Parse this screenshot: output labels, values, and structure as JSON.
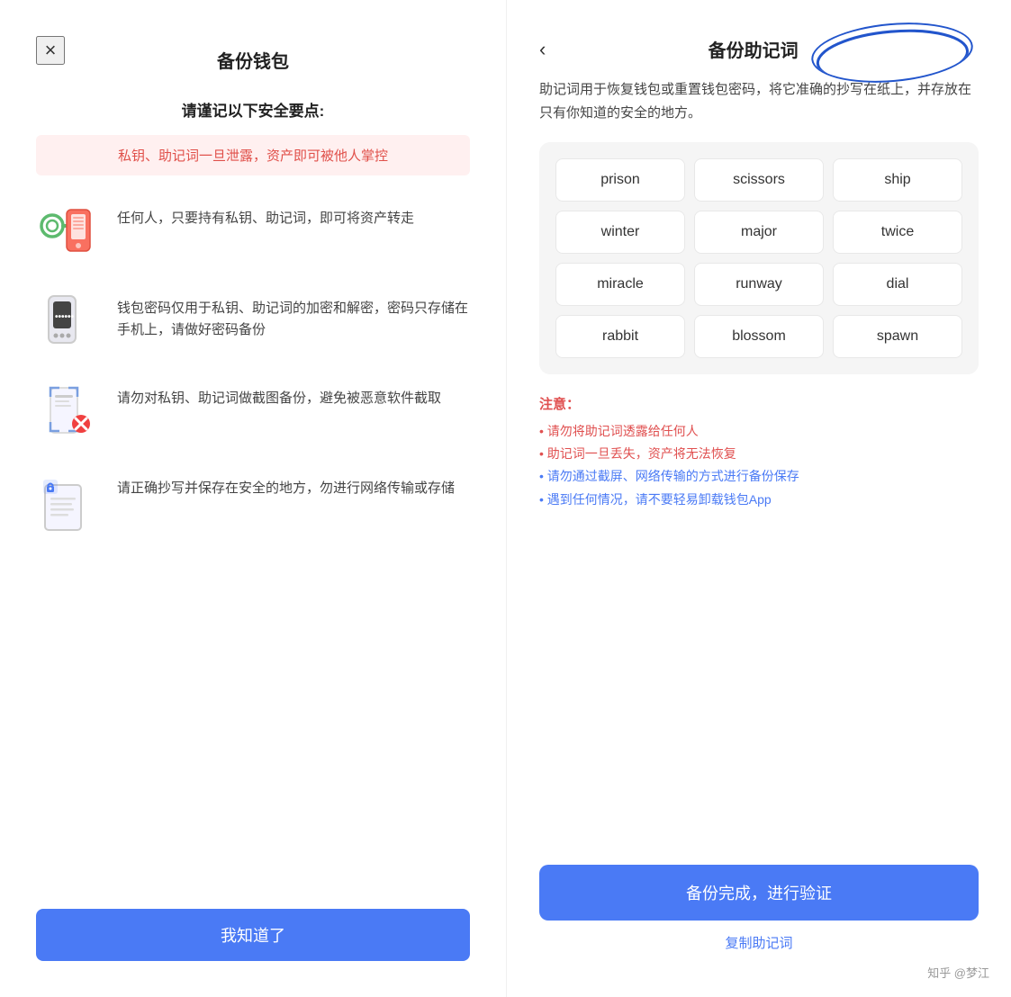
{
  "left": {
    "close_icon": "×",
    "title": "备份钱包",
    "subtitle": "请谨记以下安全要点:",
    "warning": "私钥、助记词一旦泄露，资产即可被他人掌控",
    "features": [
      {
        "icon": "🔑📱",
        "text": "任何人，只要持有私钥、助记词，即可将资产转走"
      },
      {
        "icon": "📱🔒",
        "text": "钱包密码仅用于私钥、助记词的加密和解密，密码只存储在手机上，请做好密码备份"
      },
      {
        "icon": "📱❌",
        "text": "请勿对私钥、助记词做截图备份，避免被恶意软件截取"
      },
      {
        "icon": "📄✏️",
        "text": "请正确抄写并保存在安全的地方，勿进行网络传输或存储"
      }
    ],
    "bottom_btn": "我知道了"
  },
  "right": {
    "back_icon": "‹",
    "title": "备份助记词",
    "desc": "助记词用于恢复钱包或重置钱包密码，将它准确的抄写在纸上，并存放在只有你知道的安全的地方。",
    "mnemonic_words": [
      "prison",
      "scissors",
      "ship",
      "winter",
      "major",
      "twice",
      "miracle",
      "runway",
      "dial",
      "rabbit",
      "blossom",
      "spawn"
    ],
    "notice_title": "注意：",
    "notice_items": [
      {
        "text": "• 请勿将助记词透露给任何人",
        "color": "red"
      },
      {
        "text": "• 助记词一旦丢失，资产将无法恢复",
        "color": "red"
      },
      {
        "text": "• 请勿通过截屏、网络传输的方式进行备份保存",
        "color": "blue"
      },
      {
        "text": "• 遇到任何情况，请不要轻易卸载钱包App",
        "color": "blue"
      }
    ],
    "verify_btn": "备份完成，进行验证",
    "copy_link": "复制助记词",
    "watermark": "知乎 @梦江"
  }
}
